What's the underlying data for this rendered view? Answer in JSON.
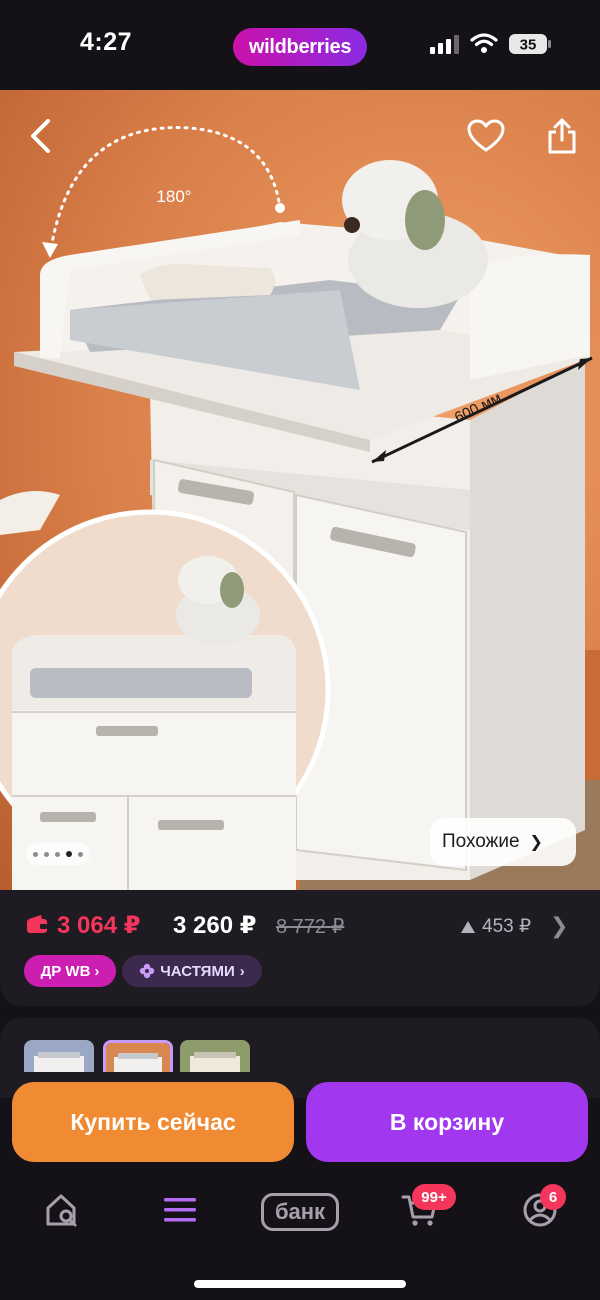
{
  "status_bar": {
    "time": "4:27",
    "app_brand": "wildberries",
    "battery": "35"
  },
  "product_image": {
    "rotation_label": "180°",
    "width_label": "600 мм",
    "similar_label": "Похожие",
    "carousel_total": 5,
    "carousel_active": 4
  },
  "pricing": {
    "wallet_price": "3 064 ₽",
    "current_price": "3 260 ₽",
    "old_price": "8 772 ₽",
    "points": "453 ₽",
    "badge_dr": "ДР WB",
    "badge_installments": "ЧАСТЯМИ"
  },
  "actions": {
    "buy_now": "Купить сейчас",
    "add_to_cart": "В корзину"
  },
  "nav": {
    "bank_label": "банк",
    "cart_count": "99+",
    "profile_count": "6"
  },
  "colors": {
    "accent_pink": "#cb11ab",
    "accent_purple": "#a137ee",
    "buy_orange": "#f08b33",
    "price_red": "#f5365c"
  }
}
